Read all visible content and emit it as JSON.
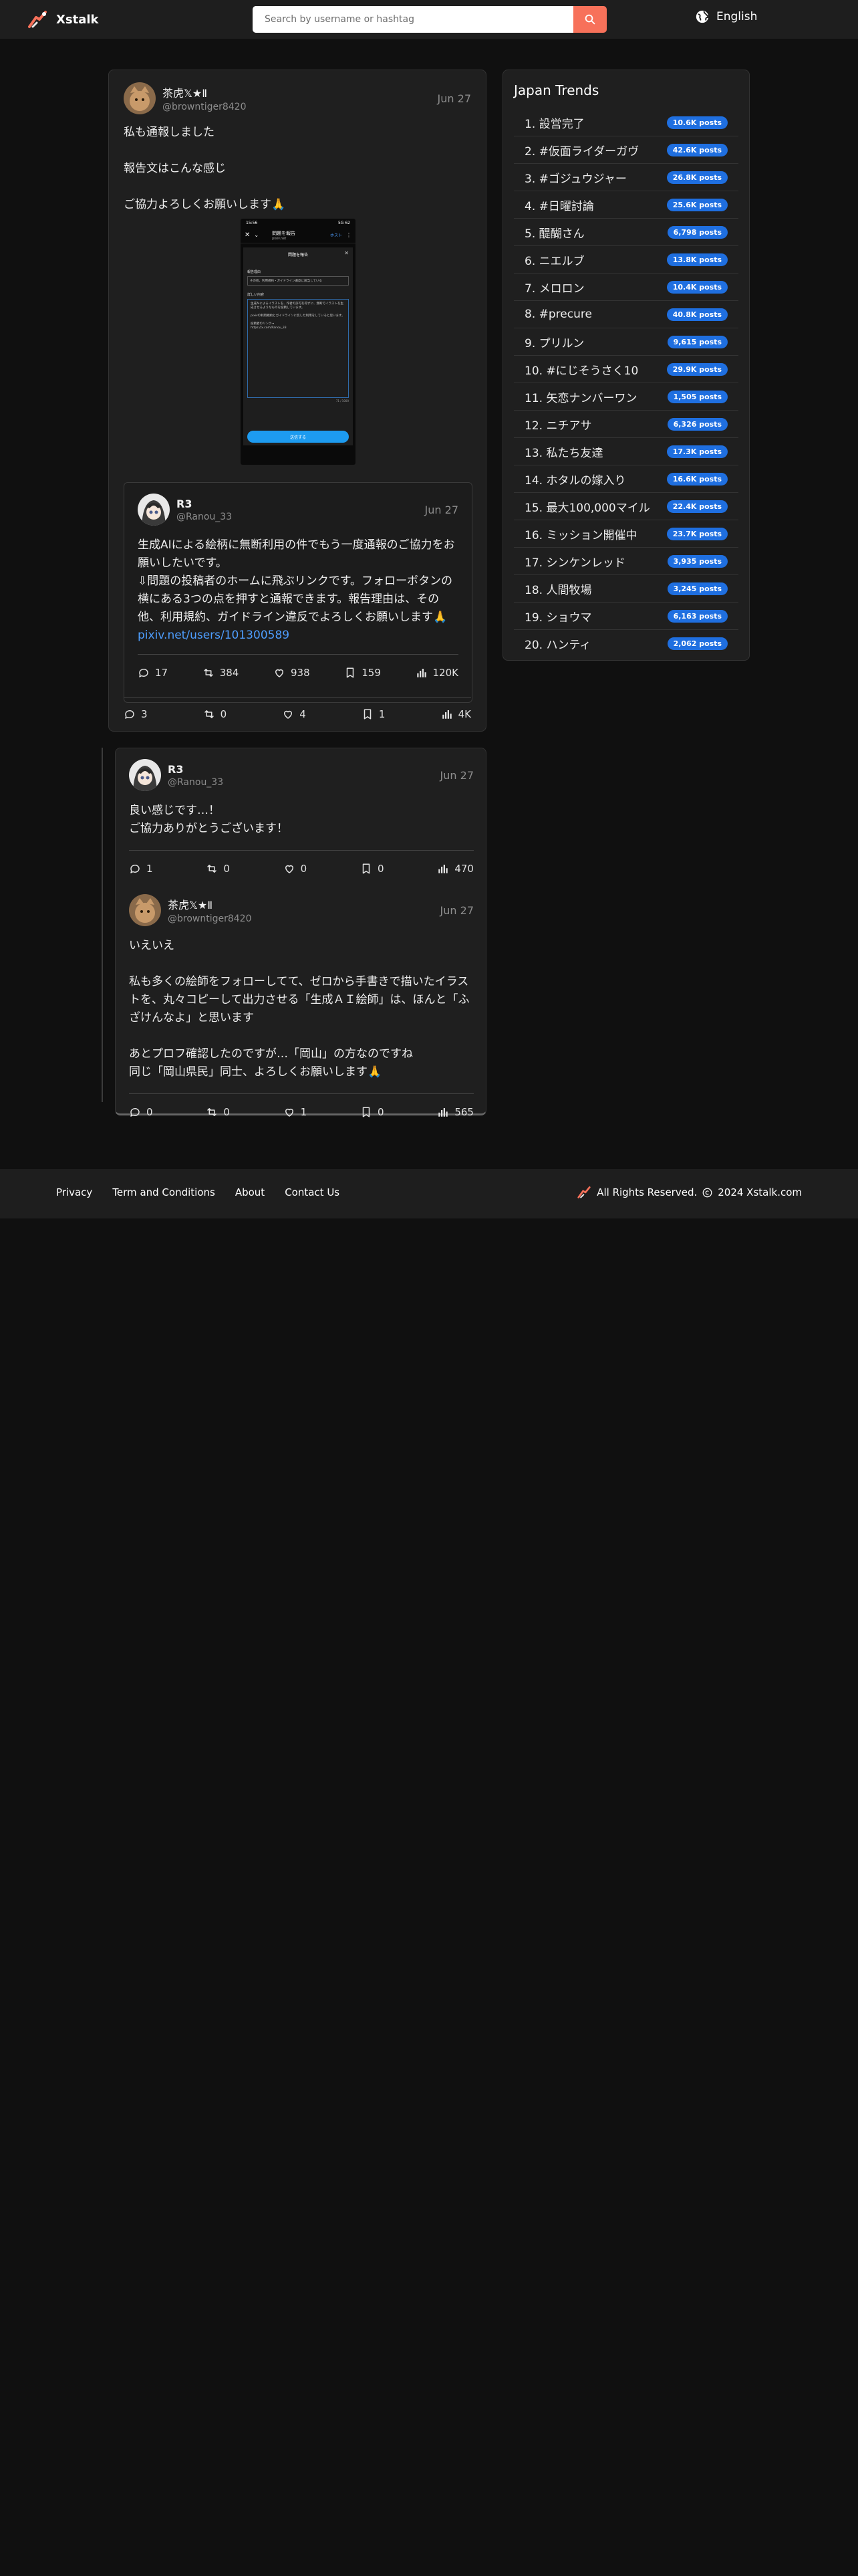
{
  "header": {
    "brand": "Xstalk",
    "search_placeholder": "Search by username or hashtag",
    "language": "English"
  },
  "main_post": {
    "display_name": "茶虎𝕏★Ⅱ",
    "username": "@browntiger8420",
    "date": "Jun 27",
    "text": "私も通報しました\n\n報告文はこんな感じ\n\nご協力よろしくお願いします🙏",
    "stats": {
      "replies": "3",
      "reposts": "0",
      "likes": "4",
      "bookmarks": "1",
      "views": "4K"
    },
    "screenshot": {
      "status_time": "15:56",
      "status_right": "5G 62",
      "tab_title": "問題を報告",
      "url_text": "pixiv.net",
      "close_text": "ホスト",
      "dialog_title": "問題を報告",
      "field_label": "報告理由",
      "field_value": "その他、利用規約・ガイドライン違反に該当している",
      "detail_label": "詳しい内容",
      "detail_text": "生成AIによるイラストを、作者の許可を得ずに、無断でイラストを生成させるようなものを投稿しています。\n\npixivの利用規約とガイドラインに反した利用をしていると思います。\n\n投稿者のリンク→\nhttps://x.com/Ranou_33",
      "counter": "71 / 1000",
      "submit": "送信する"
    },
    "quote": {
      "display_name": "R3",
      "username": "@Ranou_33",
      "date": "Jun 27",
      "text": "生成AIによる絵柄に無断利用の件でもう一度通報のご協力をお願いしたいです。\n⇩問題の投稿者のホームに飛ぶリンクです。フォローボタンの横にある3つの点を押すと通報できます。報告理由は、その他、利用規約、ガイドライン違反でよろしくお願いします🙏",
      "link": "pixiv.net/users/101300589",
      "stats": {
        "replies": "17",
        "reposts": "384",
        "likes": "938",
        "bookmarks": "159",
        "views": "120K"
      }
    }
  },
  "thread": [
    {
      "display_name": "R3",
      "username": "@Ranou_33",
      "date": "Jun 27",
      "text": "良い感じです…！\nご協力ありがとうございます！",
      "stats": {
        "replies": "1",
        "reposts": "0",
        "likes": "0",
        "bookmarks": "0",
        "views": "470"
      }
    },
    {
      "display_name": "茶虎𝕏★Ⅱ",
      "username": "@browntiger8420",
      "date": "Jun 27",
      "text": "いえいえ\n\n私も多くの絵師をフォローしてて、ゼロから手書きで描いたイラストを、丸々コピーして出力させる「生成ＡＩ絵師」は、ほんと「ふざけんなよ」と思います\n\nあとプロフ確認したのですが…「岡山」の方なのですね\n同じ「岡山県民」同士、よろしくお願いします🙏",
      "stats": {
        "replies": "0",
        "reposts": "0",
        "likes": "1",
        "bookmarks": "0",
        "views": "565"
      }
    }
  ],
  "sidebar": {
    "title": "Japan Trends",
    "trends": [
      {
        "name": "1. 設営完了",
        "posts": "10.6K posts"
      },
      {
        "name": "2. #仮面ライダーガヴ",
        "posts": "42.6K posts"
      },
      {
        "name": "3. #ゴジュウジャー",
        "posts": "26.8K posts"
      },
      {
        "name": "4. #日曜討論",
        "posts": "25.6K posts"
      },
      {
        "name": "5. 醍醐さん",
        "posts": "6,798 posts"
      },
      {
        "name": "6. ニエルブ",
        "posts": "13.8K posts"
      },
      {
        "name": "7. メロロン",
        "posts": "10.4K posts"
      },
      {
        "name": "8. #precure",
        "posts": "40.8K posts"
      },
      {
        "name": "9. プリルン",
        "posts": "9,615 posts"
      },
      {
        "name": "10. #にじそうさく10",
        "posts": "29.9K posts"
      },
      {
        "name": "11. 矢恋ナンバーワン",
        "posts": "1,505 posts"
      },
      {
        "name": "12. ニチアサ",
        "posts": "6,326 posts"
      },
      {
        "name": "13. 私たち友達",
        "posts": "17.3K posts"
      },
      {
        "name": "14. ホタルの嫁入り",
        "posts": "16.6K posts"
      },
      {
        "name": "15. 最大100,000マイル",
        "posts": "22.4K posts"
      },
      {
        "name": "16. ミッション開催中",
        "posts": "23.7K posts"
      },
      {
        "name": "17. シンケンレッド",
        "posts": "3,935 posts"
      },
      {
        "name": "18. 人間牧場",
        "posts": "3,245 posts"
      },
      {
        "name": "19. ショウマ",
        "posts": "6,163 posts"
      },
      {
        "name": "20. ハンティ",
        "posts": "2,062 posts"
      }
    ]
  },
  "footer": {
    "links": [
      "Privacy",
      "Term and Conditions",
      "About",
      "Contact Us"
    ],
    "rights": "All Rights Reserved.",
    "copyright": "2024 Xstalk.com"
  },
  "colors": {
    "accent": "#f7715a",
    "badge": "#1f6fe0",
    "link": "#4e9eff",
    "background": "#101010",
    "card": "#1f1f1f"
  }
}
